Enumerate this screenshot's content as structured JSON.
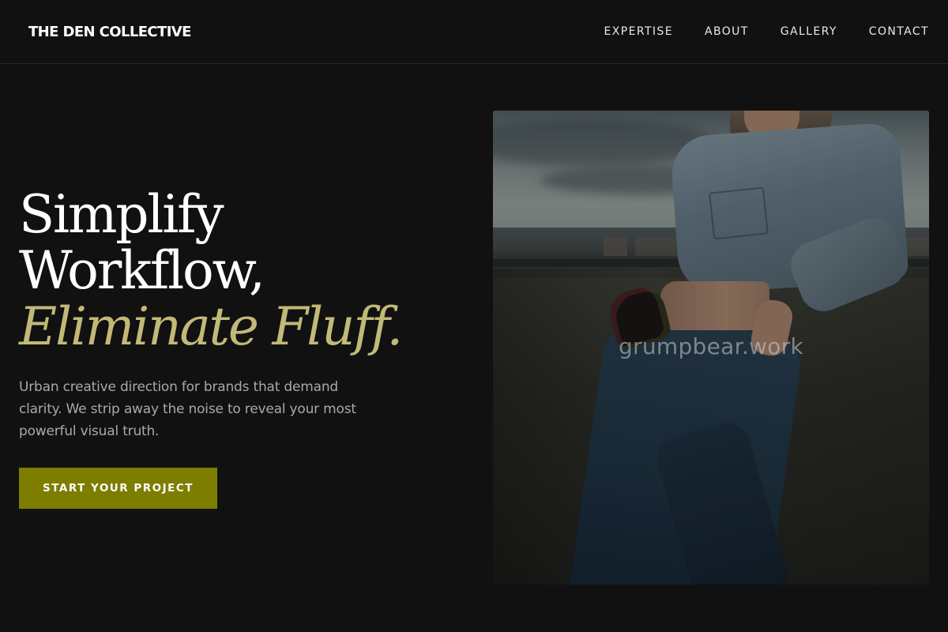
{
  "header": {
    "brand": "THE DEN COLLECTIVE",
    "nav": [
      {
        "label": "EXPERTISE"
      },
      {
        "label": "ABOUT"
      },
      {
        "label": "GALLERY"
      },
      {
        "label": "CONTACT"
      }
    ]
  },
  "hero": {
    "title_line1": "Simplify",
    "title_line2": "Workflow,",
    "title_accent": "Eliminate Fluff.",
    "description": "Urban creative direction for brands that demand clarity. We strip away the noise to reveal your most powerful visual truth.",
    "cta_label": "START YOUR PROJECT",
    "image_watermark": "grumpbear.work"
  },
  "colors": {
    "background": "#111111",
    "accent_text": "#c2b978",
    "cta_background": "#7d7d00",
    "body_text": "#a9a9a9"
  }
}
